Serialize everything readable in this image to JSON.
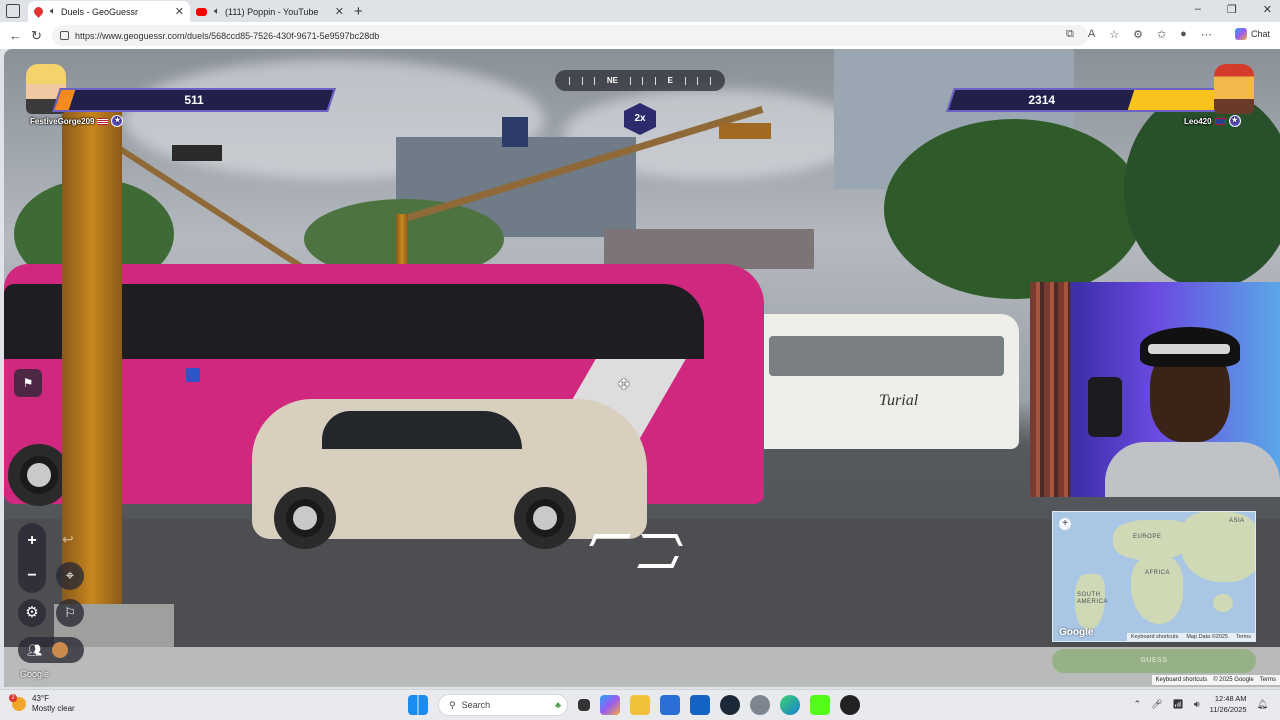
{
  "browser": {
    "tabs": [
      {
        "title": "Duels - GeoGuessr",
        "active": true
      },
      {
        "title": "(111) Poppin - YouTube",
        "active": false
      }
    ],
    "url": "https://www.geoguessr.com/duels/568ccd85-7526-430f-9671-5e9597bc28db",
    "chat_label": "Chat",
    "window_controls": [
      "–",
      "❐",
      "✕"
    ]
  },
  "game": {
    "player_left": {
      "name": "FestiveGorge209",
      "health": 511,
      "health_fraction": 0.05,
      "flag": "us",
      "bar_color": "#f68a1f"
    },
    "player_right": {
      "name": "Leo420",
      "health": 2314,
      "health_fraction": 0.35,
      "flag": "gb",
      "bar_color": "#f7c31c"
    },
    "compass": {
      "labels": [
        "NE",
        "E"
      ]
    },
    "multiplier": "2x",
    "controls": {
      "zoom_in": "+",
      "zoom_out": "−",
      "undo": "↩"
    },
    "google_label": "Google",
    "bus_brand": "Turial"
  },
  "minimap": {
    "labels": [
      "EUROPE",
      "AFRICA",
      "ASIA",
      "SOUTH AMERICA"
    ],
    "attribution": [
      "Keyboard shortcuts",
      "Map Data ©2025",
      "Terms"
    ],
    "google_mark": "Google",
    "guess_label": "GUESS"
  },
  "map_footer": [
    "Keyboard shortcuts",
    "© 2025 Google",
    "Terms"
  ],
  "taskbar": {
    "weather_temp": "43°F",
    "weather_desc": "Mostly clear",
    "weather_badge": "2",
    "search_placeholder": "Search",
    "time": "12:48 AM",
    "date": "11/26/2025"
  },
  "colors": {
    "accent_purple": "#6c62c6",
    "hp_bg": "#22204a",
    "bus_pink": "#d0287f"
  }
}
